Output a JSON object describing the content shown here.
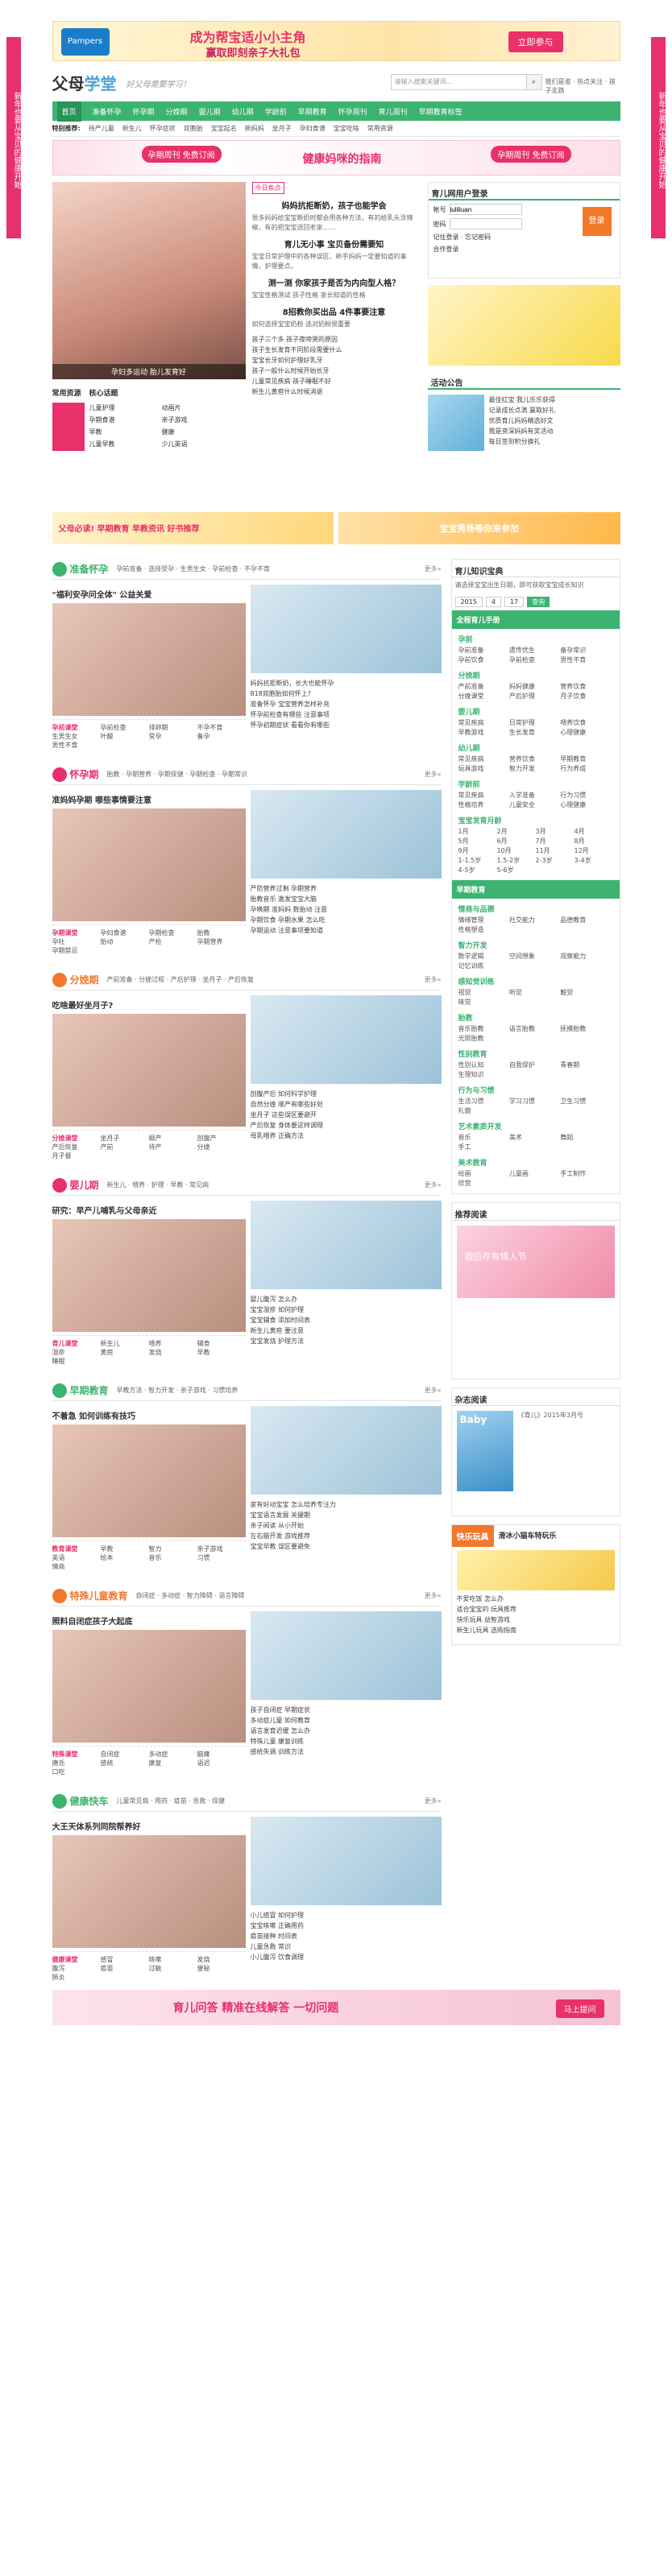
{
  "side": {
    "left": "新年也要从宝贝的健康开始",
    "right": "新年也要从宝贝的健康开始"
  },
  "top_banner": {
    "brand": "Pampers",
    "title": "成为帮宝适小小主角",
    "subtitle": "赢取即刻亲子大礼包",
    "cta": "立即参与"
  },
  "header": {
    "logo_a": "父母",
    "logo_b": "学堂",
    "slogan": "好父母需要学习！",
    "search_placeholder": "请输入搜索关键词...",
    "links": "我们是谁 · 热点关注 · 孩子走路"
  },
  "nav": [
    "首页",
    "准备怀孕",
    "怀孕期",
    "分娩期",
    "婴儿期",
    "幼儿期",
    "学龄前",
    "早期教育",
    "怀孕周刊",
    "育儿周刊",
    "早期教育标签"
  ],
  "subnav": {
    "label": "特别推荐:",
    "items": [
      "待产儿童",
      "新生儿",
      "怀孕症状",
      "双胞胎",
      "宝宝起名",
      "新妈妈",
      "坐月子",
      "孕妇食谱",
      "宝宝吃啥",
      "常用资源"
    ]
  },
  "pink_banner": {
    "left": "孕期周刊 免费订阅",
    "center": "健康妈咪的指南",
    "right": "孕期周刊 免费订阅"
  },
  "hero": {
    "photo_caption": "孕妇多运动 胎儿发育好",
    "tag": "今日焦点",
    "headline": "妈妈抗拒断奶，孩子也能学会",
    "headline_text": "很多妈妈给宝宝断奶时都会用各种方法，有的给乳头涂辣椒，有的把宝宝送回老家……",
    "h2": "育儿无小事 宝贝备份需要知",
    "h2_text": "宝宝日常护理中的各种误区，新手妈妈一定要知道的事情，护理要点。",
    "h3": "测一测 你家孩子是否为内向型人格？",
    "h3_text": "宝宝性格测试 孩子性格 家长知道的性格",
    "h4": "8招教你买出品 4件事要注意",
    "h4_text": "如何选择宝宝奶粉 选对奶粉很重要",
    "list": [
      "孩子三个多 孩子夜啼哭的原因",
      "孩子生长发育不同阶段需要什么",
      "宝宝长牙如何护理好乳牙",
      "孩子一般什么时候开始长牙",
      "儿童常见疾病 孩子睡眠不好",
      "新生儿黄疸什么时候消退"
    ],
    "tabs": [
      "常用资源",
      "核心话题"
    ],
    "quick": [
      "儿童护理",
      "动画片",
      "孕期食谱",
      "亲子游戏",
      "早教",
      "健康",
      "儿童早教",
      "少儿英语"
    ]
  },
  "login": {
    "title": "育儿网用户登录",
    "user_label": "帐号",
    "user_value": "iuliliuan",
    "pass_label": "密码",
    "btn": "登录",
    "remember": "记住登录 · 忘记密码",
    "other": "合作登录"
  },
  "notice": {
    "title": "活动公告",
    "items": [
      "最佳红宝 我儿乐乐获得",
      "记录成长点滴 赢取好礼",
      "优质育儿妈妈精选好文",
      "我是资深妈妈有奖活动",
      "每日签到积分换礼"
    ]
  },
  "ad_mid": {
    "left": "父母必读! 早期教育 早教资讯 好书推荐",
    "right": "宝宝秀场等你来参加"
  },
  "sections": [
    {
      "name": "准备怀孕",
      "color": "#3cb371",
      "subs": "孕前准备 · 选择受孕 · 生男生女 · 孕前检查 · 不孕不育",
      "headline": "\"福利安孕问全体\" 公益关爱",
      "items": [
        "妈妈抗拒断奶，长大也能怀孕",
        "818双胞胎如何怀上?",
        "准备怀孕 宝宝营养怎样补充",
        "怀孕前检查有哪些 注意事项",
        "怀孕初期症状 看看你有哪些"
      ],
      "kw_label": "孕前课堂",
      "kws": [
        "孕前检查",
        "排卵期",
        "不孕不育",
        "生男生女",
        "叶酸",
        "受孕",
        "备孕",
        "男性不育"
      ]
    },
    {
      "name": "怀孕期",
      "color": "#e8306a",
      "subs": "胎教 · 孕期营养 · 孕期保健 · 孕期检查 · 孕期常识",
      "headline": "准妈妈孕期 哪些事情要注意",
      "items": [
        "严防营养过剩 孕期营养",
        "胎教音乐 激发宝宝大脑",
        "孕晚期 准妈妈 数胎动 注意",
        "孕期饮食 孕期水果 怎么吃",
        "孕期运动 注意事项要知道"
      ],
      "kw_label": "孕期课堂",
      "kws": [
        "孕妇食谱",
        "孕期检查",
        "胎教",
        "孕吐",
        "胎动",
        "产检",
        "孕期营养",
        "孕期禁忌"
      ]
    },
    {
      "name": "分娩期",
      "color": "#f2792a",
      "subs": "产前准备 · 分娩过程 · 产后护理 · 坐月子 · 产后恢复",
      "headline": "吃啥最好坐月子?",
      "items": [
        "剖腹产后 如何科学护理",
        "自然分娩 顺产有哪些好处",
        "坐月子 这些误区要避开",
        "产后恢复 身体要这样调理",
        "母乳喂养 正确方法"
      ],
      "kw_label": "分娩课堂",
      "kws": [
        "坐月子",
        "顺产",
        "剖腹产",
        "产后恢复",
        "产前",
        "待产",
        "分娩",
        "月子餐"
      ]
    },
    {
      "name": "婴儿期",
      "color": "#e8306a",
      "subs": "新生儿 · 喂养 · 护理 · 早教 · 常见病",
      "headline": "研究：早产儿哺乳与父母亲近",
      "items": [
        "婴儿腹泻 怎么办",
        "宝宝湿疹 如何护理",
        "宝宝辅食 添加时间表",
        "新生儿黄疸 要注意",
        "宝宝发烧 护理方法"
      ],
      "kw_label": "育儿课堂",
      "kws": [
        "新生儿",
        "喂养",
        "辅食",
        "湿疹",
        "黄疸",
        "发烧",
        "早教",
        "睡眠"
      ]
    },
    {
      "name": "早期教育",
      "color": "#3cb371",
      "subs": "早教方法 · 智力开发 · 亲子游戏 · 习惯培养",
      "headline": "不着急 如何训练有技巧",
      "items": [
        "家有好动宝宝 怎么培养专注力",
        "宝宝语言发展 关键期",
        "亲子阅读 从小开始",
        "左右脑开发 游戏推荐",
        "宝宝早教 误区要避免"
      ],
      "kw_label": "教育课堂",
      "kws": [
        "早教",
        "智力",
        "亲子游戏",
        "英语",
        "绘本",
        "音乐",
        "习惯",
        "情商"
      ]
    },
    {
      "name": "特殊儿童教育",
      "color": "#f2792a",
      "subs": "自闭症 · 多动症 · 智力障碍 · 语言障碍",
      "headline": "照料自闭症孩子大起底",
      "items": [
        "孩子自闭症 早期症状",
        "多动症儿童 如何教育",
        "语言发育迟缓 怎么办",
        "特殊儿童 康复训练",
        "感统失调 训练方法"
      ],
      "kw_label": "特殊课堂",
      "kws": [
        "自闭症",
        "多动症",
        "脑瘫",
        "唐氏",
        "感统",
        "康复",
        "语迟",
        "口吃"
      ]
    },
    {
      "name": "健康快车",
      "color": "#3cb371",
      "subs": "儿童常见病 · 用药 · 疫苗 · 急救 · 保健",
      "headline": "大王天体系列同院帮养好",
      "items": [
        "小儿感冒 如何护理",
        "宝宝咳嗽 正确用药",
        "疫苗接种 时间表",
        "儿童急救 常识",
        "小儿腹泻 饮食调理"
      ],
      "kw_label": "健康课堂",
      "kws": [
        "感冒",
        "咳嗽",
        "发烧",
        "腹泻",
        "疫苗",
        "过敏",
        "便秘",
        "肺炎"
      ]
    }
  ],
  "right": {
    "dict_title": "育儿知识宝典",
    "dict_desc": "请选择宝宝出生日期，即可获取宝宝成长知识",
    "year": "2015",
    "month": "4",
    "day": "17",
    "search_btn": "查询",
    "cat_title": "全程育儿手册",
    "cal_title": "怀孕期",
    "cats": [
      {
        "h": "孕前",
        "items": [
          "孕前准备",
          "遗传优生",
          "备孕常识",
          "孕前饮食",
          "孕前检查",
          "男性不育"
        ]
      },
      {
        "h": "分娩期",
        "items": [
          "产前准备",
          "妈妈健康",
          "营养饮食",
          "分娩课堂",
          "产后护理",
          "月子饮食"
        ]
      },
      {
        "h": "婴儿期",
        "items": [
          "常见疾病",
          "日常护理",
          "喂养饮食",
          "早教游戏",
          "生长发育",
          "心理健康"
        ]
      },
      {
        "h": "幼儿期",
        "items": [
          "常见疾病",
          "营养饮食",
          "早期教育",
          "玩具游戏",
          "智力开发",
          "行为养成"
        ]
      },
      {
        "h": "学龄前",
        "items": [
          "常见疾病",
          "入学准备",
          "行为习惯",
          "性格培养",
          "儿童安全",
          "心理健康"
        ]
      }
    ],
    "age_title": "宝宝发育月龄",
    "ages": [
      "1月",
      "2月",
      "3月",
      "4月",
      "5月",
      "6月",
      "7月",
      "8月",
      "9月",
      "10月",
      "11月",
      "12月",
      "1-1.5岁",
      "1.5-2岁",
      "2-3岁",
      "3-4岁",
      "4-5岁",
      "5-6岁"
    ],
    "early_title": "早期教育",
    "early_cats": [
      {
        "h": "情商与品德",
        "items": [
          "情绪管理",
          "社交能力",
          "品德教育",
          "性格塑造"
        ]
      },
      {
        "h": "智力开发",
        "items": [
          "数学逻辑",
          "空间想象",
          "观察能力",
          "记忆训练"
        ]
      },
      {
        "h": "感知觉训练",
        "items": [
          "视觉",
          "听觉",
          "触觉",
          "味觉"
        ]
      },
      {
        "h": "胎教",
        "items": [
          "音乐胎教",
          "语言胎教",
          "抚摸胎教",
          "光照胎教"
        ]
      },
      {
        "h": "性别教育",
        "items": [
          "性别认知",
          "自我保护",
          "青春期",
          "生理知识"
        ]
      },
      {
        "h": "行为与习惯",
        "items": [
          "生活习惯",
          "学习习惯",
          "卫生习惯",
          "礼貌"
        ]
      },
      {
        "h": "艺术素质开发",
        "items": [
          "音乐",
          "美术",
          "舞蹈",
          "手工"
        ]
      },
      {
        "h": "美术教育",
        "items": [
          "绘画",
          "儿童画",
          "手工制作",
          "欣赏"
        ]
      }
    ],
    "rec_title": "推荐阅读",
    "rec_item": "婚后存有情人节",
    "mag_title": "杂志阅读",
    "mag_name": "Baby",
    "mag_issue": "《育儿》2015年3月号",
    "fun_title": "快乐玩具",
    "fun_item": "滑冰小猫车特玩乐",
    "fun_list": [
      "不爱吃饭 怎么办",
      "适合宝宝的 玩具推荐",
      "快乐玩具 益智游戏",
      "新生儿玩具 选购指南"
    ]
  },
  "bottom_ad": {
    "text": "育儿问答 精准在线解答 一切问题",
    "cta": "马上提问"
  }
}
